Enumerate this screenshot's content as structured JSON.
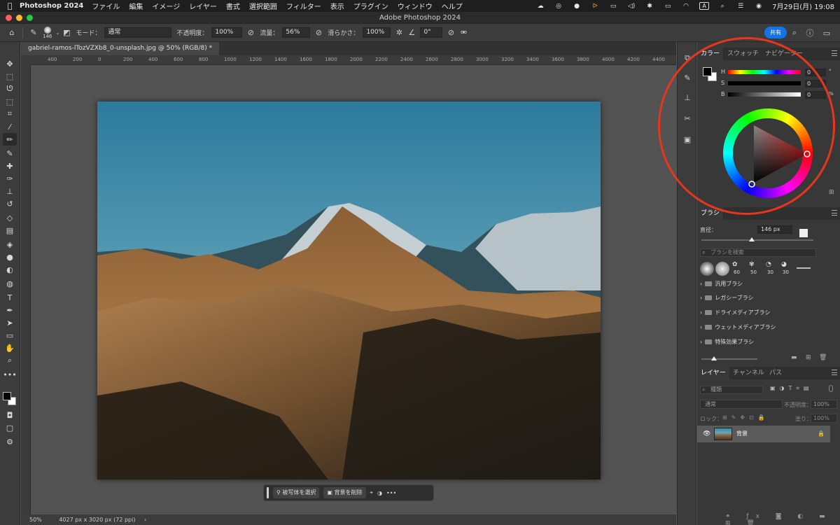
{
  "menubar": {
    "app_name": "Photoshop 2024",
    "items": [
      "ファイル",
      "編集",
      "イメージ",
      "レイヤー",
      "書式",
      "選択範囲",
      "フィルター",
      "表示",
      "プラグイン",
      "ウィンドウ",
      "ヘルプ"
    ],
    "input_indicator": "A",
    "datetime": "7月29日(月)  19:08"
  },
  "window": {
    "title": "Adobe Photoshop 2024"
  },
  "options": {
    "brush_size": "146",
    "mode_label": "モード：",
    "mode_value": "通常",
    "opacity_label": "不透明度：",
    "opacity_value": "100%",
    "flow_label": "流量：",
    "flow_value": "56%",
    "smoothing_label": "滑らかさ：",
    "smoothing_value": "100%",
    "angle_value": "0°",
    "share_label": "共有"
  },
  "document": {
    "tab_title": "gabriel-ramos-lTozVZXb8_0-unsplash.jpg @ 50% (RGB/8) *",
    "ruler_marks": [
      "400",
      "200",
      "0",
      "200",
      "400",
      "600",
      "800",
      "1000",
      "1200",
      "1400",
      "1600",
      "1800",
      "2000",
      "2200",
      "2400",
      "2600",
      "2800",
      "3000",
      "3200",
      "3400",
      "3600",
      "3800",
      "4000",
      "4200",
      "4400"
    ],
    "zoom": "50%",
    "doc_info": "4027 px x 3020 px (72 ppi)"
  },
  "contextbar": {
    "select_subject": "被写体を選択",
    "remove_bg": "背景を削除",
    "more": "•••"
  },
  "color_panel": {
    "tabs": [
      "カラー",
      "スウォッチ",
      "ナビゲーター"
    ],
    "h_label": "H",
    "h_value": "0",
    "h_unit": "°",
    "s_label": "S",
    "s_value": "0",
    "b_label": "B",
    "b_value": "0",
    "b_unit": "%"
  },
  "brush_panel": {
    "title": "ブラシ",
    "size_label": "直径：",
    "size_value": "146 px",
    "search_placeholder": "ブラシを検索",
    "preset_sizes": [
      "60",
      "50",
      "30",
      "30"
    ],
    "folders": [
      "汎用ブラシ",
      "レガシーブラシ",
      "ドライメディアブラシ",
      "ウェットメディアブラシ",
      "特殊効果ブラシ"
    ]
  },
  "layers_panel": {
    "tabs": [
      "レイヤー",
      "チャンネル",
      "パス"
    ],
    "filter_label": "種類",
    "blend_mode": "通常",
    "opacity_label": "不透明度：",
    "opacity_value": "100%",
    "lock_label": "ロック：",
    "fill_label": "塗り：",
    "fill_value": "100%",
    "layer_name": "背景"
  },
  "colors": {
    "accent": "#1473e6",
    "annotation": "#e8361d",
    "foreground": "#000000",
    "background": "#ffffff"
  }
}
